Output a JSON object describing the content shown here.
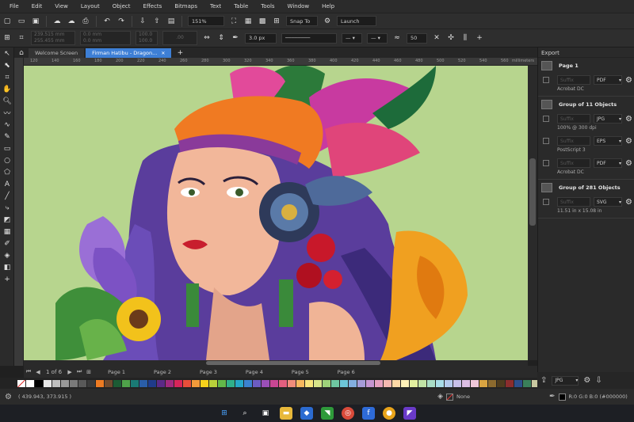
{
  "menu": [
    "File",
    "Edit",
    "View",
    "Layout",
    "Object",
    "Effects",
    "Bitmaps",
    "Text",
    "Table",
    "Tools",
    "Window",
    "Help"
  ],
  "toolbar": {
    "zoom": "151%",
    "snap": "Snap To",
    "launch": "Launch"
  },
  "propbar": {
    "pos_x": "239.515 mm",
    "pos_y": "255.455 mm",
    "w": "0.0 mm",
    "h": "0.0 mm",
    "scale_w": "100.0",
    "scale_h": "100.0",
    "angle": ".00",
    "outline": "3.0 px",
    "smooth": "50"
  },
  "tabs": [
    {
      "label": "Welcome Screen",
      "active": false
    },
    {
      "label": "Firman Hatibu - Dragon...",
      "active": true
    }
  ],
  "ruler": {
    "ticks": [
      "120",
      "140",
      "160",
      "180",
      "200",
      "220",
      "240",
      "260",
      "280",
      "300",
      "320",
      "340",
      "360",
      "380",
      "400",
      "420",
      "440",
      "460",
      "480",
      "500",
      "520",
      "540",
      "560"
    ],
    "units": "millimeters"
  },
  "pages": {
    "counter": "1 of 6",
    "tabs": [
      "Page 1",
      "Page 2",
      "Page 3",
      "Page 4",
      "Page 5",
      "Page 6"
    ]
  },
  "palette": [
    "#ffffff",
    "#000000",
    "#e6e6e6",
    "#bfbfbf",
    "#999999",
    "#7a7a7a",
    "#595959",
    "#3a3a3a",
    "#ee7b22",
    "#6f4a2e",
    "#1c5b34",
    "#4fa24a",
    "#1a7a75",
    "#2a5ea8",
    "#1f3b8a",
    "#5b2a86",
    "#a12a7e",
    "#d8255a",
    "#e84e3a",
    "#f29a3a",
    "#f6d21b",
    "#b9d13a",
    "#63b849",
    "#2fb08a",
    "#25a7c8",
    "#3b82d0",
    "#6c5cc2",
    "#9b4fb8",
    "#c94693",
    "#e35f7f",
    "#f18c7a",
    "#f7b85e",
    "#f8e57d",
    "#d7e48a",
    "#9ed27a",
    "#6ec7a1",
    "#6dc6d9",
    "#82aee0",
    "#a59bd8",
    "#c595d1",
    "#e5a0bf",
    "#f4b7b0",
    "#ffd9a6",
    "#fff1b8",
    "#e2ef9f",
    "#c1e3a5",
    "#a8dcc6",
    "#a8dce8",
    "#b3c9ec",
    "#c7bfe8",
    "#dbbde3",
    "#f0c7d9",
    "#d9a441",
    "#8c6a2e",
    "#4d3b1e",
    "#8b2d2d",
    "#2e4f8b",
    "#3a7f5a",
    "#c8c8a0",
    "#6e6e8e"
  ],
  "status": {
    "coords": "( 439.943, 373.915 )",
    "fill": "None",
    "color_info": "R:0 G:0 B:0 (#000000)"
  },
  "docker": {
    "title": "Export",
    "groups": [
      {
        "name": "Page 1",
        "rows": [
          {
            "suffix": "Suffix",
            "format": "PDF",
            "info": "Acrobat DC"
          }
        ]
      },
      {
        "name": "Group of 11 Objects",
        "rows": [
          {
            "suffix": "Suffix",
            "format": "JPG",
            "info": "100% @ 300 dpi"
          },
          {
            "suffix": "Suffix",
            "format": "EPS",
            "info": "PostScript 3"
          },
          {
            "suffix": "Suffix",
            "format": "PDF",
            "info": "Acrobat DC"
          }
        ]
      },
      {
        "name": "Group of 281 Objects",
        "rows": [
          {
            "suffix": "Suffix",
            "format": "SVG",
            "info": "11.51 in x 15.08 in"
          }
        ]
      }
    ],
    "footer_format": "JPG"
  }
}
